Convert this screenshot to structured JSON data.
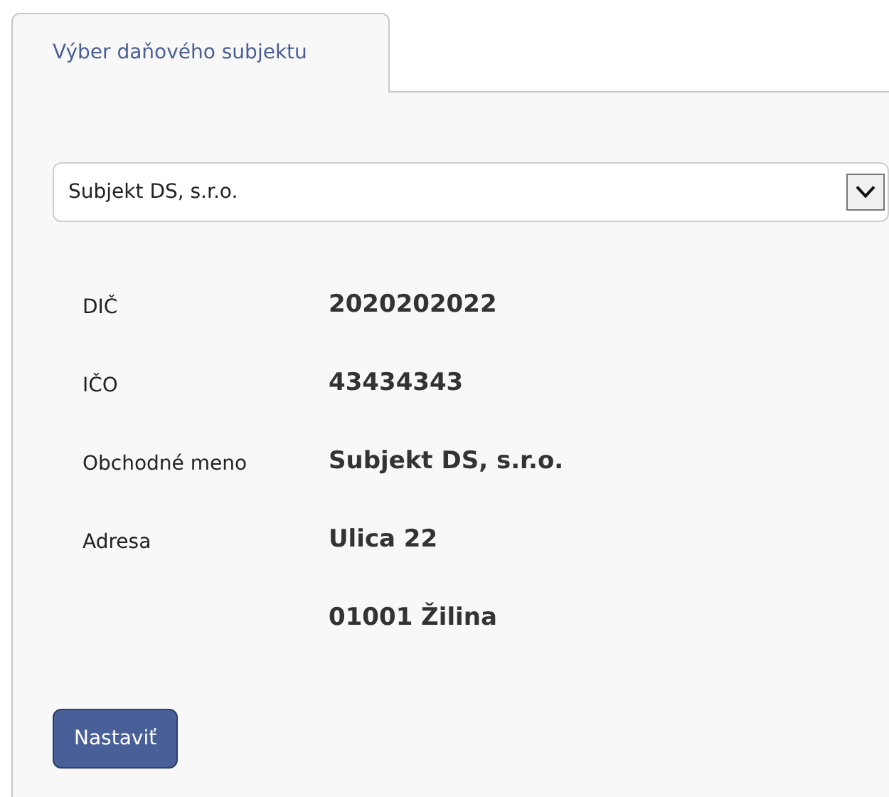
{
  "tabs": [
    {
      "label": "Výber daňového subjektu",
      "selected": true
    }
  ],
  "subject_select": {
    "value": "Subjekt DS, s.r.o."
  },
  "details": [
    {
      "label": "DIČ",
      "value": "2020202022"
    },
    {
      "label": "IČO",
      "value": "43434343"
    },
    {
      "label": "Obchodné meno",
      "value": "Subjekt DS, s.r.o."
    },
    {
      "label": "Adresa",
      "value": "Ulica 22"
    },
    {
      "value": "01001 Žilina"
    }
  ],
  "buttons": [
    {
      "label": "Nastaviť"
    }
  ]
}
